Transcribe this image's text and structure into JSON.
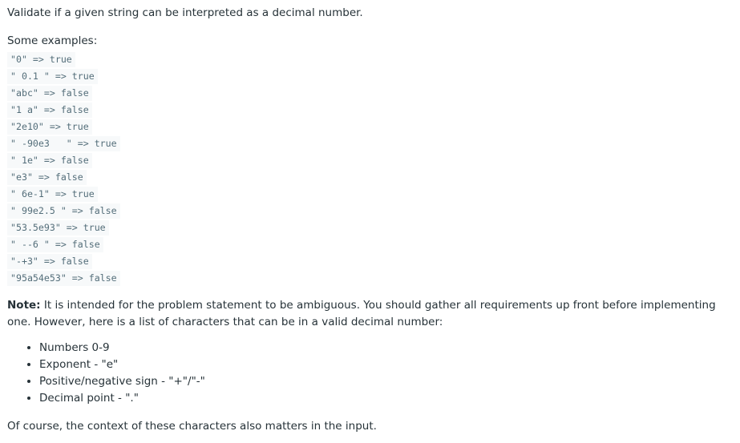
{
  "intro": "Validate if a given string can be interpreted as a decimal number.",
  "examples_label": "Some examples:",
  "examples": [
    "\"0\" => true",
    "\" 0.1 \" => true",
    "\"abc\" => false",
    "\"1 a\" => false",
    "\"2e10\" => true",
    "\" -90e3   \" => true",
    "\" 1e\" => false",
    "\"e3\" => false",
    "\" 6e-1\" => true",
    "\" 99e2.5 \" => false",
    "\"53.5e93\" => true",
    "\" --6 \" => false",
    "\"-+3\" => false",
    "\"95a54e53\" => false"
  ],
  "note": {
    "label": "Note:",
    "text": " It is intended for the problem statement to be ambiguous. You should gather all requirements up front before implementing one. However, here is a list of characters that can be in a valid decimal number:"
  },
  "characters": [
    "Numbers 0-9",
    "Exponent - \"e\"",
    "Positive/negative sign - \"+\"/\"-\"",
    "Decimal point - \".\""
  ],
  "outro": "Of course, the context of these characters also matters in the input."
}
